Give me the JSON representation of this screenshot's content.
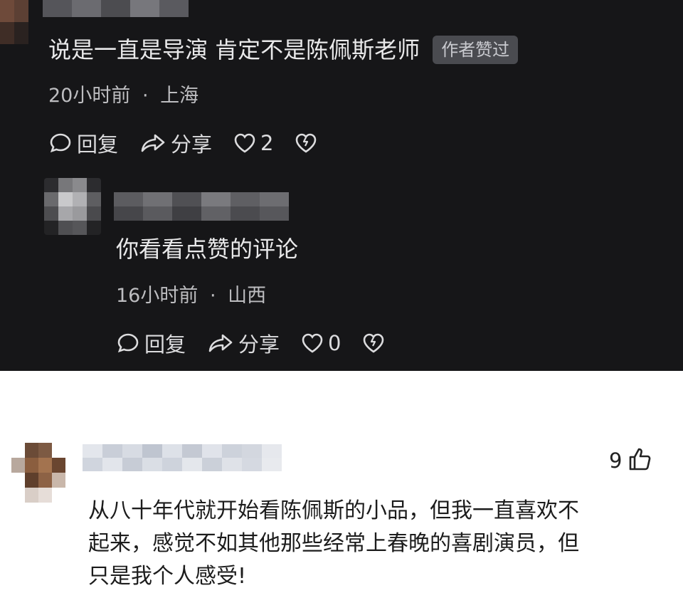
{
  "comment_1": {
    "text": "说是一直是导演 肯定不是陈佩斯老师",
    "badge": "作者赞过",
    "time": "20小时前",
    "location": "上海",
    "reply_label": "回复",
    "share_label": "分享",
    "like_count": "2"
  },
  "comment_2": {
    "text": "你看看点赞的评论",
    "time": "16小时前",
    "location": "山西",
    "reply_label": "回复",
    "share_label": "分享",
    "like_count": "0"
  },
  "comment_3": {
    "like_count": "9",
    "text_lines": [
      "从八十年代就开始看陈佩斯的小品，但我一直喜欢不",
      "起来，感觉不如其他那些经常上春晚的喜剧演员，但",
      "只是我个人感受!"
    ]
  },
  "separator": "·",
  "icons": {
    "reply": "comment-bubble-icon",
    "share": "share-arrow-icon",
    "like": "heart-icon",
    "dislike": "broken-heart-icon",
    "thumb": "thumbs-up-icon"
  },
  "colors": {
    "dark_background": "#161618",
    "light_background": "#ffffff",
    "badge_background": "#4a4b50"
  }
}
